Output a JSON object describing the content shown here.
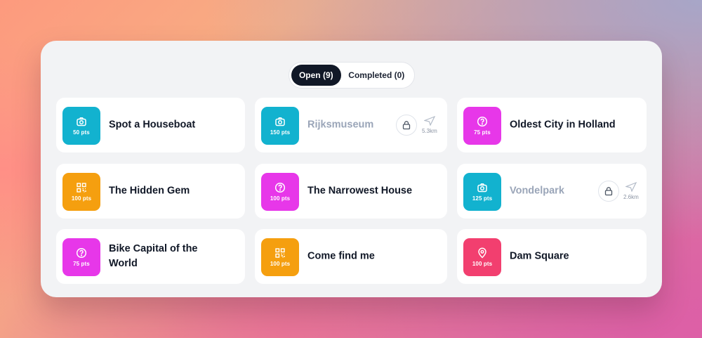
{
  "tabs": {
    "open_label": "Open (9)",
    "completed_label": "Completed (0)"
  },
  "colors": {
    "photo": "#12b2cf",
    "question": "#e737e9",
    "qr": "#f59f0f",
    "location": "#f23f6f",
    "active_tab": "#111827"
  },
  "challenges": [
    {
      "title": "Spot a Houseboat",
      "points": "50 pts",
      "icon": "camera-icon",
      "type": "photo",
      "locked": false
    },
    {
      "title": "Rijksmuseum",
      "points": "150 pts",
      "icon": "camera-icon",
      "type": "photo",
      "locked": true,
      "distance": "5.3km"
    },
    {
      "title": "Oldest City in Holland",
      "points": "75 pts",
      "icon": "question-icon",
      "type": "question",
      "locked": false
    },
    {
      "title": "The Hidden Gem",
      "points": "100 pts",
      "icon": "qr-code-icon",
      "type": "qr",
      "locked": false
    },
    {
      "title": "The Narrowest House",
      "points": "100 pts",
      "icon": "question-icon",
      "type": "question",
      "locked": false
    },
    {
      "title": "Vondelpark",
      "points": "125 pts",
      "icon": "camera-icon",
      "type": "photo",
      "locked": true,
      "distance": "2.6km"
    },
    {
      "title": "Bike Capital of the World",
      "points": "75 pts",
      "icon": "question-icon",
      "type": "question",
      "locked": false
    },
    {
      "title": "Come find me",
      "points": "100 pts",
      "icon": "qr-code-icon",
      "type": "qr",
      "locked": false
    },
    {
      "title": "Dam Square",
      "points": "100 pts",
      "icon": "location-pin-icon",
      "type": "location",
      "locked": false
    }
  ]
}
